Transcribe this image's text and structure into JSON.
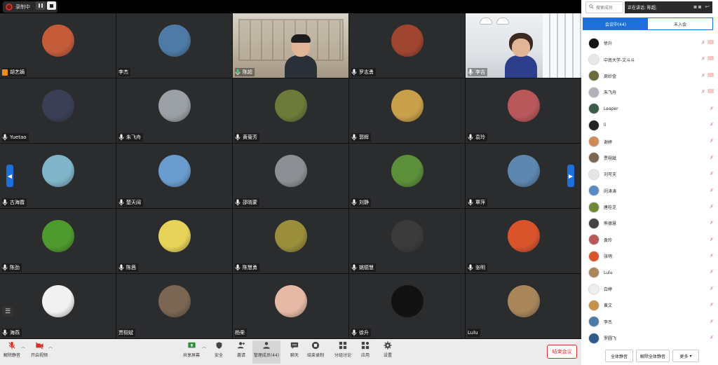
{
  "recording": {
    "label": "录制中"
  },
  "grid": {
    "tiles": [
      {
        "name": "胡艺嫡",
        "kind": "avatar",
        "color": "#c45c3a",
        "host": true
      },
      {
        "name": "李杰",
        "kind": "avatar",
        "color": "#4d7ba6",
        "nomic": true
      },
      {
        "name": "陈超",
        "kind": "video1"
      },
      {
        "name": "罗志勇",
        "kind": "avatar",
        "color": "#a0452f"
      },
      {
        "name": "李吉",
        "kind": "video2"
      },
      {
        "name": "Yuetao",
        "kind": "avatar",
        "color": "#3a3f55"
      },
      {
        "name": "朱飞舟",
        "kind": "avatar",
        "color": "#9aa0a5"
      },
      {
        "name": "黄菊芳",
        "kind": "avatar",
        "color": "#6d7a3a"
      },
      {
        "name": "郭辉",
        "kind": "avatar",
        "color": "#c9a04a"
      },
      {
        "name": "袁玲",
        "kind": "avatar",
        "color": "#b9585a"
      },
      {
        "name": "古海霞",
        "kind": "avatar",
        "color": "#7fb4c9"
      },
      {
        "name": "楚天阔",
        "kind": "avatar",
        "color": "#6a9ccf"
      },
      {
        "name": "邵晓蒙",
        "kind": "avatar",
        "color": "#8c8f93"
      },
      {
        "name": "刘静",
        "kind": "avatar",
        "color": "#5c8f3a"
      },
      {
        "name": "覃萍",
        "kind": "avatar",
        "color": "#5d86b0"
      },
      {
        "name": "陈劲",
        "kind": "avatar",
        "color": "#4f9a2e"
      },
      {
        "name": "陈茜",
        "kind": "avatar",
        "color": "#e7d35a"
      },
      {
        "name": "陈慧勇",
        "kind": "avatar",
        "color": "#9a8e3a"
      },
      {
        "name": "姚德慧",
        "kind": "avatar",
        "color": "#3b3b3b"
      },
      {
        "name": "张明",
        "kind": "avatar",
        "color": "#d9542b"
      },
      {
        "name": "海燕",
        "kind": "avatar",
        "color": "#f1f1f1"
      },
      {
        "name": "贾栩斌",
        "kind": "avatar",
        "color": "#7a6652",
        "nomic": true
      },
      {
        "name": "杨荣",
        "kind": "avatar",
        "color": "#e6b9a6",
        "nomic": true
      },
      {
        "name": "徐升",
        "kind": "avatar",
        "color": "#111111"
      },
      {
        "name": "Lulu",
        "kind": "avatar",
        "color": "#a8865a",
        "nomic": true
      }
    ]
  },
  "toolbar": {
    "mute": "解除静音",
    "video": "开启视频",
    "share": "共享屏幕",
    "security": "安全",
    "invite": "邀请",
    "members": "管理成员(44)",
    "chat": "聊天",
    "stop_record": "结束录制",
    "breakout": "分组讨论",
    "apps": "应用",
    "settings": "设置",
    "end_meeting": "结束会议"
  },
  "panel": {
    "search_placeholder": "搜索成员",
    "speaking": "正在讲话: 陈超;",
    "tab_in": "会议中(44)",
    "tab_out": "未入会",
    "members": [
      {
        "name": "徐升",
        "color": "#111111",
        "cam": true
      },
      {
        "name": "中南大学-文斗斗",
        "color": "#e8e8e8",
        "cam": true
      },
      {
        "name": "周妙金",
        "color": "#6f6a3c",
        "cam": true
      },
      {
        "name": "朱飞舟",
        "color": "#b0b4b8",
        "cam": true
      },
      {
        "name": "Leaper",
        "color": "#3a5a4a"
      },
      {
        "name": "li",
        "color": "#222222"
      },
      {
        "name": "谢婷",
        "color": "#d08a5a"
      },
      {
        "name": "贾栩斌",
        "color": "#7a6652"
      },
      {
        "name": "刘可夫",
        "color": "#e5e5e5"
      },
      {
        "name": "闵涛涛",
        "color": "#5a8ac0"
      },
      {
        "name": "唐桂芝",
        "color": "#6c8a3a"
      },
      {
        "name": "熊德慧",
        "color": "#444444"
      },
      {
        "name": "袁玲",
        "color": "#b9585a"
      },
      {
        "name": "张明",
        "color": "#d9542b"
      },
      {
        "name": "Lulu",
        "color": "#a8865a"
      },
      {
        "name": "白婷",
        "color": "#eeeeee"
      },
      {
        "name": "黄文",
        "color": "#c4924a"
      },
      {
        "name": "李杰",
        "color": "#4d7ba6"
      },
      {
        "name": "罗圆飞",
        "color": "#2f5a8a"
      }
    ],
    "mute_all": "全体静音",
    "unmute_all": "解除全体静音",
    "more": "更多"
  }
}
